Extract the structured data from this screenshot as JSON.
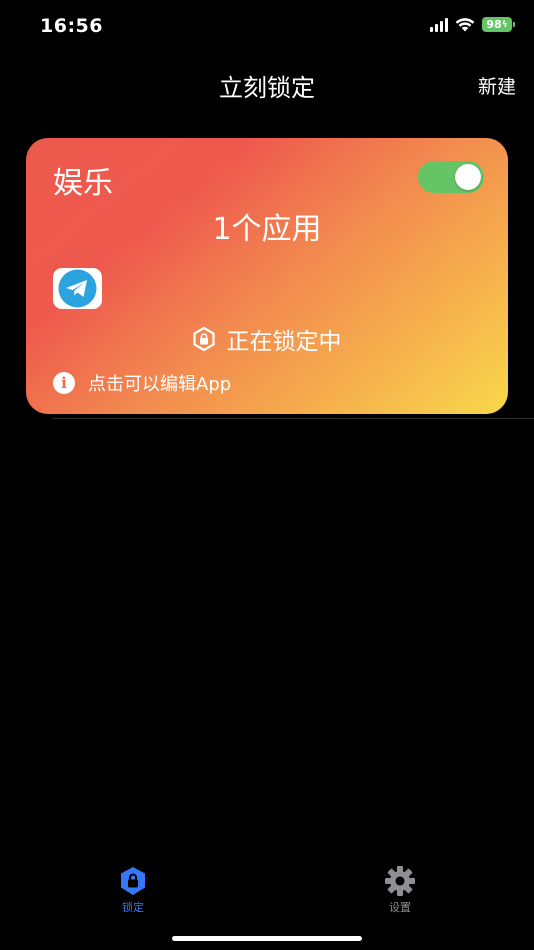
{
  "status_bar": {
    "time": "16:56",
    "battery": "98"
  },
  "nav": {
    "title": "立刻锁定",
    "new_button": "新建"
  },
  "lock_card": {
    "title": "娱乐",
    "toggle_on": true,
    "app_count": "1个应用",
    "apps": [
      "telegram-icon"
    ],
    "status": "正在锁定中",
    "edit_hint": "点击可以编辑App"
  },
  "tab_bar": {
    "items": [
      {
        "label": "锁定",
        "icon": "shield-lock-icon",
        "active": true
      },
      {
        "label": "设置",
        "icon": "gear-icon",
        "active": false
      }
    ]
  },
  "colors": {
    "accent": "#3478f6",
    "toggle_on": "#65c466",
    "card_gradient_start": "#ec5a4d",
    "card_gradient_end": "#f8d84b",
    "telegram_blue": "#2aa3df"
  }
}
